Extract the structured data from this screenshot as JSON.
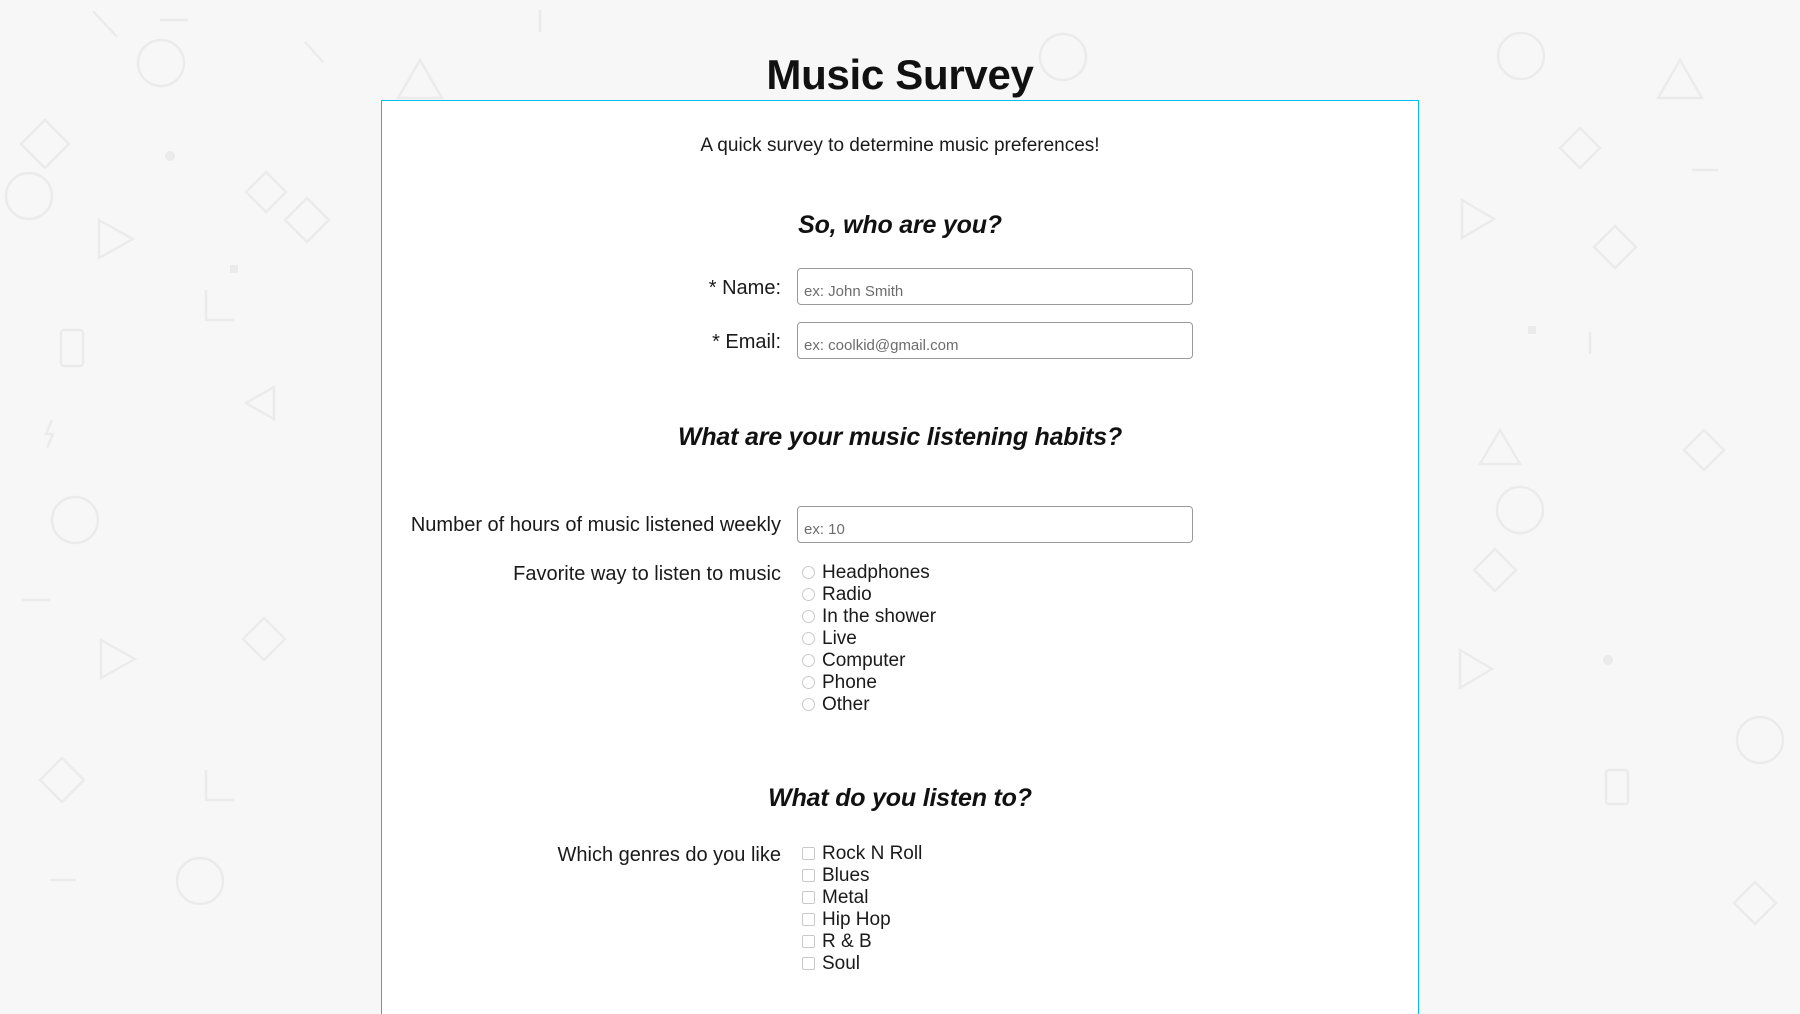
{
  "page": {
    "title": "Music Survey",
    "background_color": "#f7f7f7",
    "accent_color": "#00c0f0"
  },
  "card": {
    "description": "A quick survey to determine music preferences!",
    "sections": [
      {
        "heading": "So, who are you?",
        "fields": [
          {
            "label": "* Name:",
            "placeholder": "ex: John Smith",
            "value": "",
            "type": "text"
          },
          {
            "label": "* Email:",
            "placeholder": "ex: coolkid@gmail.com",
            "value": "",
            "type": "text"
          }
        ]
      },
      {
        "heading": "What are your music listening habits?",
        "hours": {
          "label": "Number of hours of music listened weekly",
          "placeholder": "ex: 10",
          "value": ""
        },
        "listen_way": {
          "label": "Favorite way to listen to music",
          "options": [
            "Headphones",
            "Radio",
            "In the shower",
            "Live",
            "Computer",
            "Phone",
            "Other"
          ]
        }
      },
      {
        "heading": "What do you listen to?",
        "genres": {
          "label": "Which genres do you like",
          "options": [
            "Rock N Roll",
            "Blues",
            "Metal",
            "Hip Hop",
            "R & B",
            "Soul"
          ]
        }
      }
    ]
  }
}
